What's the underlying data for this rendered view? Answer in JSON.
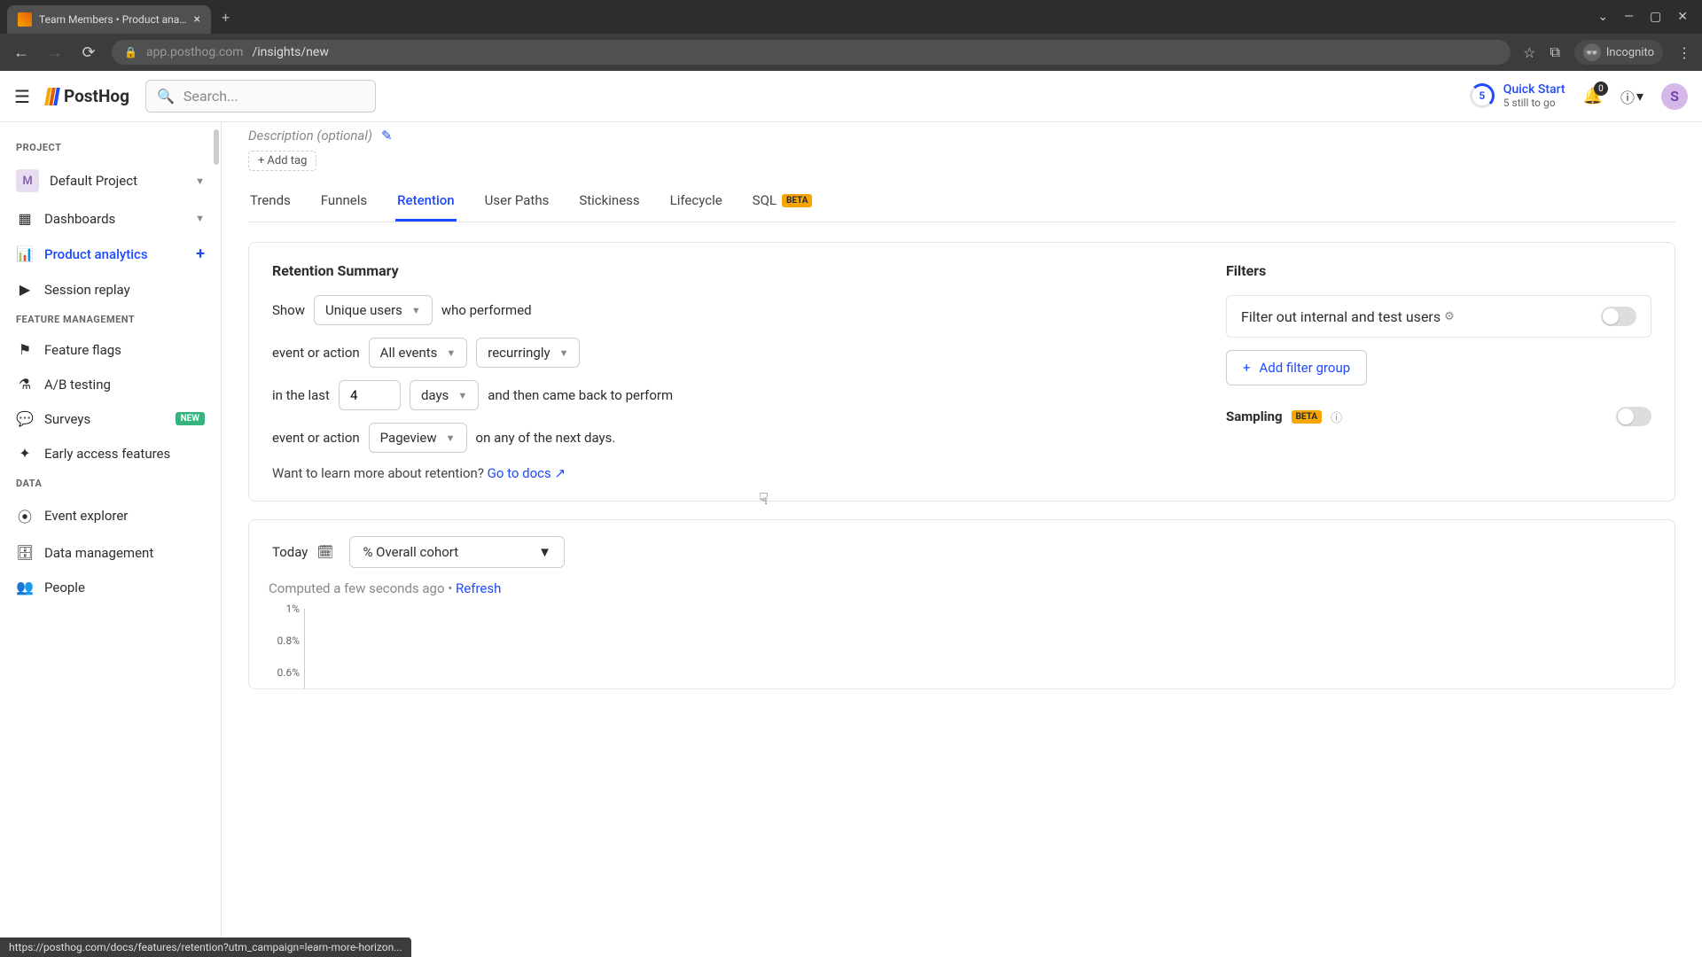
{
  "browser": {
    "tab_title": "Team Members • Product analyt",
    "url_host": "app.posthog.com",
    "url_path": "/insights/new",
    "incognito": "Incognito",
    "status_url": "https://posthog.com/docs/features/retention?utm_campaign=learn-more-horizon..."
  },
  "header": {
    "logo_text": "PostHog",
    "search_placeholder": "Search...",
    "quick_start_title": "Quick Start",
    "quick_start_sub": "5 still to go",
    "quick_start_count": "5",
    "notif_count": "0",
    "avatar_letter": "S"
  },
  "sidebar": {
    "sections": {
      "project": "PROJECT",
      "feature": "FEATURE MANAGEMENT",
      "data": "DATA"
    },
    "project_letter": "M",
    "project_name": "Default Project",
    "items": {
      "dashboards": "Dashboards",
      "analytics": "Product analytics",
      "replay": "Session replay",
      "flags": "Feature flags",
      "ab": "A/B testing",
      "surveys": "Surveys",
      "early": "Early access features",
      "explorer": "Event explorer",
      "datamgmt": "Data management",
      "people": "People"
    },
    "new_badge": "NEW"
  },
  "page": {
    "description_placeholder": "Description (optional)",
    "add_tag": "Add tag",
    "tabs": {
      "trends": "Trends",
      "funnels": "Funnels",
      "retention": "Retention",
      "paths": "User Paths",
      "stickiness": "Stickiness",
      "lifecycle": "Lifecycle",
      "sql": "SQL",
      "beta": "BETA"
    },
    "retention": {
      "title": "Retention Summary",
      "show": "Show",
      "users_dd": "Unique users",
      "who_performed": "who performed",
      "event_or_action": "event or action",
      "events_dd": "All events",
      "recurring_dd": "recurringly",
      "in_last": "in the last",
      "period_value": "4",
      "period_unit": "days",
      "came_back": "and then came back to perform",
      "return_event_dd": "Pageview",
      "on_any": "on any of the next days.",
      "learn_text": "Want to learn more about retention? ",
      "learn_link": "Go to docs"
    },
    "filters": {
      "title": "Filters",
      "internal": "Filter out internal and test users",
      "add_group": "Add filter group",
      "sampling": "Sampling"
    },
    "results": {
      "today": "Today",
      "cohort": "% Overall cohort",
      "computed": "Computed a few seconds ago • ",
      "refresh": "Refresh"
    }
  },
  "chart_data": {
    "type": "line",
    "title": "",
    "xlabel": "",
    "ylabel": "",
    "ylim": [
      0,
      0.01
    ],
    "yticks": [
      "1%",
      "0.8%",
      "0.6%"
    ],
    "categories": [],
    "series": []
  }
}
